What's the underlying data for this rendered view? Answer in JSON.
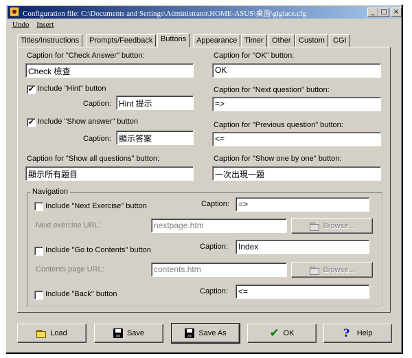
{
  "window": {
    "title": "Configuration file: C:\\Documents and Settings\\Administrator.HOME-ASUS\\桌面\\glglace.cfg",
    "minimize": "_",
    "maximize": "□",
    "close": "×"
  },
  "menu": {
    "undo": "Undo",
    "insert": "Insert"
  },
  "tabs": [
    {
      "label": "Titles/Instructions"
    },
    {
      "label": "Prompts/Feedback"
    },
    {
      "label": "Buttons"
    },
    {
      "label": "Appearance"
    },
    {
      "label": "Timer"
    },
    {
      "label": "Other"
    },
    {
      "label": "Custom"
    },
    {
      "label": "CGI"
    }
  ],
  "buttons_tab": {
    "check_answer_label": "Caption for \"Check Answer\" button:",
    "check_answer_value": "Check 檢查",
    "ok_label": "Caption for \"OK\" button:",
    "ok_value": "OK",
    "include_hint_label": "Include \"Hint\" button",
    "include_hint_checked": "✔",
    "hint_caption_label": "Caption:",
    "hint_caption_value": "Hint 提示",
    "next_question_label": "Caption for \"Next question\" button:",
    "next_question_value": "=>",
    "include_show_answer_label": "Include \"Show answer\" button",
    "include_show_answer_checked": "✔",
    "show_answer_caption_label": "Caption:",
    "show_answer_caption_value": "顯示答案",
    "previous_question_label": "Caption for \"Previous question\" button:",
    "previous_question_value": "<=",
    "show_all_label": "Caption for \"Show all questions\" button:",
    "show_all_value": "顯示所有題目",
    "show_one_label": "Caption for \"Show one by one\" button:",
    "show_one_value": "一次出現一題"
  },
  "navigation": {
    "title": "Navigation",
    "next_exercise_label": "Include \"Next Exercise\" button",
    "next_exercise_caption_label": "Caption:",
    "next_exercise_caption_value": "=>",
    "next_exercise_url_label": "Next exercise URL:",
    "next_exercise_url_value": "nextpage.htm",
    "browse_label": "Browse...",
    "contents_label": "Include \"Go to Contents\" button",
    "contents_caption_label": "Caption:",
    "contents_caption_value": "Index",
    "contents_url_label": "Contents page URL:",
    "contents_url_value": "contents.htm",
    "back_label": "Include \"Back\" button",
    "back_caption_label": "Caption:",
    "back_caption_value": "<="
  },
  "footer": {
    "load": "Load",
    "save": "Save",
    "save_as": "Save As",
    "ok": "OK",
    "help": "Help"
  }
}
